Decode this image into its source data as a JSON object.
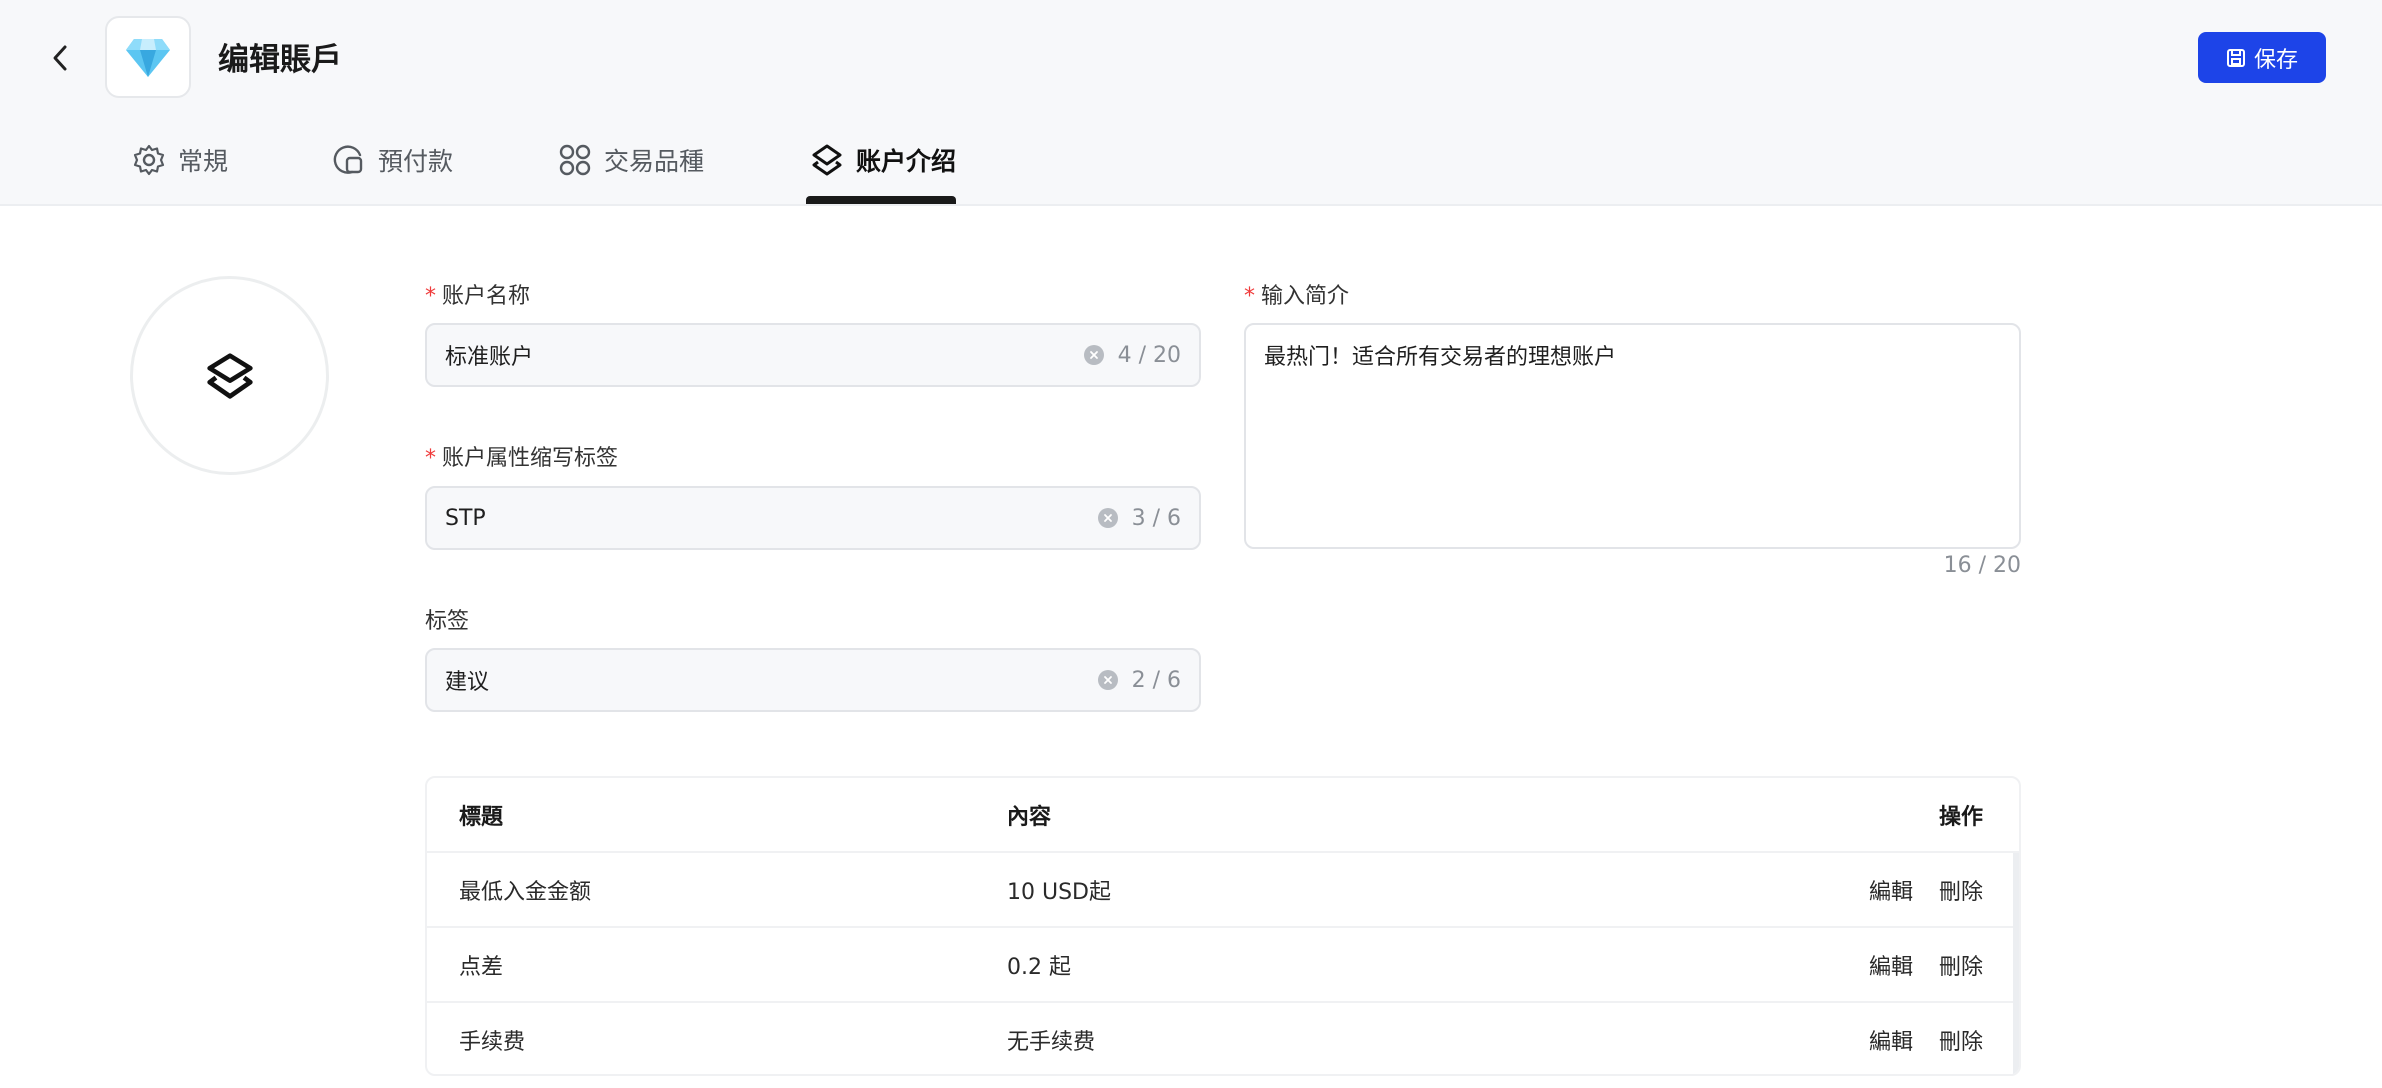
{
  "header": {
    "title": "编辑賬戶",
    "save_label": "保存"
  },
  "tabs": [
    {
      "label": "常規",
      "icon": "gear-icon",
      "active": false
    },
    {
      "label": "預付款",
      "icon": "prepayment-icon",
      "active": false
    },
    {
      "label": "交易品種",
      "icon": "grid-icon",
      "active": false
    },
    {
      "label": "账户介绍",
      "icon": "layers-icon",
      "active": true
    }
  ],
  "form": {
    "account_name": {
      "label": "账户名称",
      "required": true,
      "value": "标准账户",
      "count": "4 / 20"
    },
    "attr_tag": {
      "label": "账户属性缩写标签",
      "required": true,
      "value": "STP",
      "count": "3 / 6"
    },
    "tag": {
      "label": "标签",
      "required": false,
      "value": "建议",
      "count": "2 / 6"
    },
    "intro": {
      "label": "输入简介",
      "required": true,
      "value": "最热门！适合所有交易者的理想账户",
      "count": "16 / 20"
    }
  },
  "table": {
    "headers": {
      "title": "標題",
      "content": "內容",
      "actions": "操作"
    },
    "rows": [
      {
        "title": "最低入金金额",
        "content": "10 USD起",
        "edit": "編輯",
        "delete": "刪除"
      },
      {
        "title": "点差",
        "content": "0.2 起",
        "edit": "編輯",
        "delete": "刪除"
      },
      {
        "title": "手续费",
        "content": "无手续费",
        "edit": "編輯",
        "delete": "刪除"
      }
    ]
  },
  "colors": {
    "primary": "#1d44e8",
    "required": "#ef3b3b",
    "header_bg": "#f7f8fa"
  }
}
